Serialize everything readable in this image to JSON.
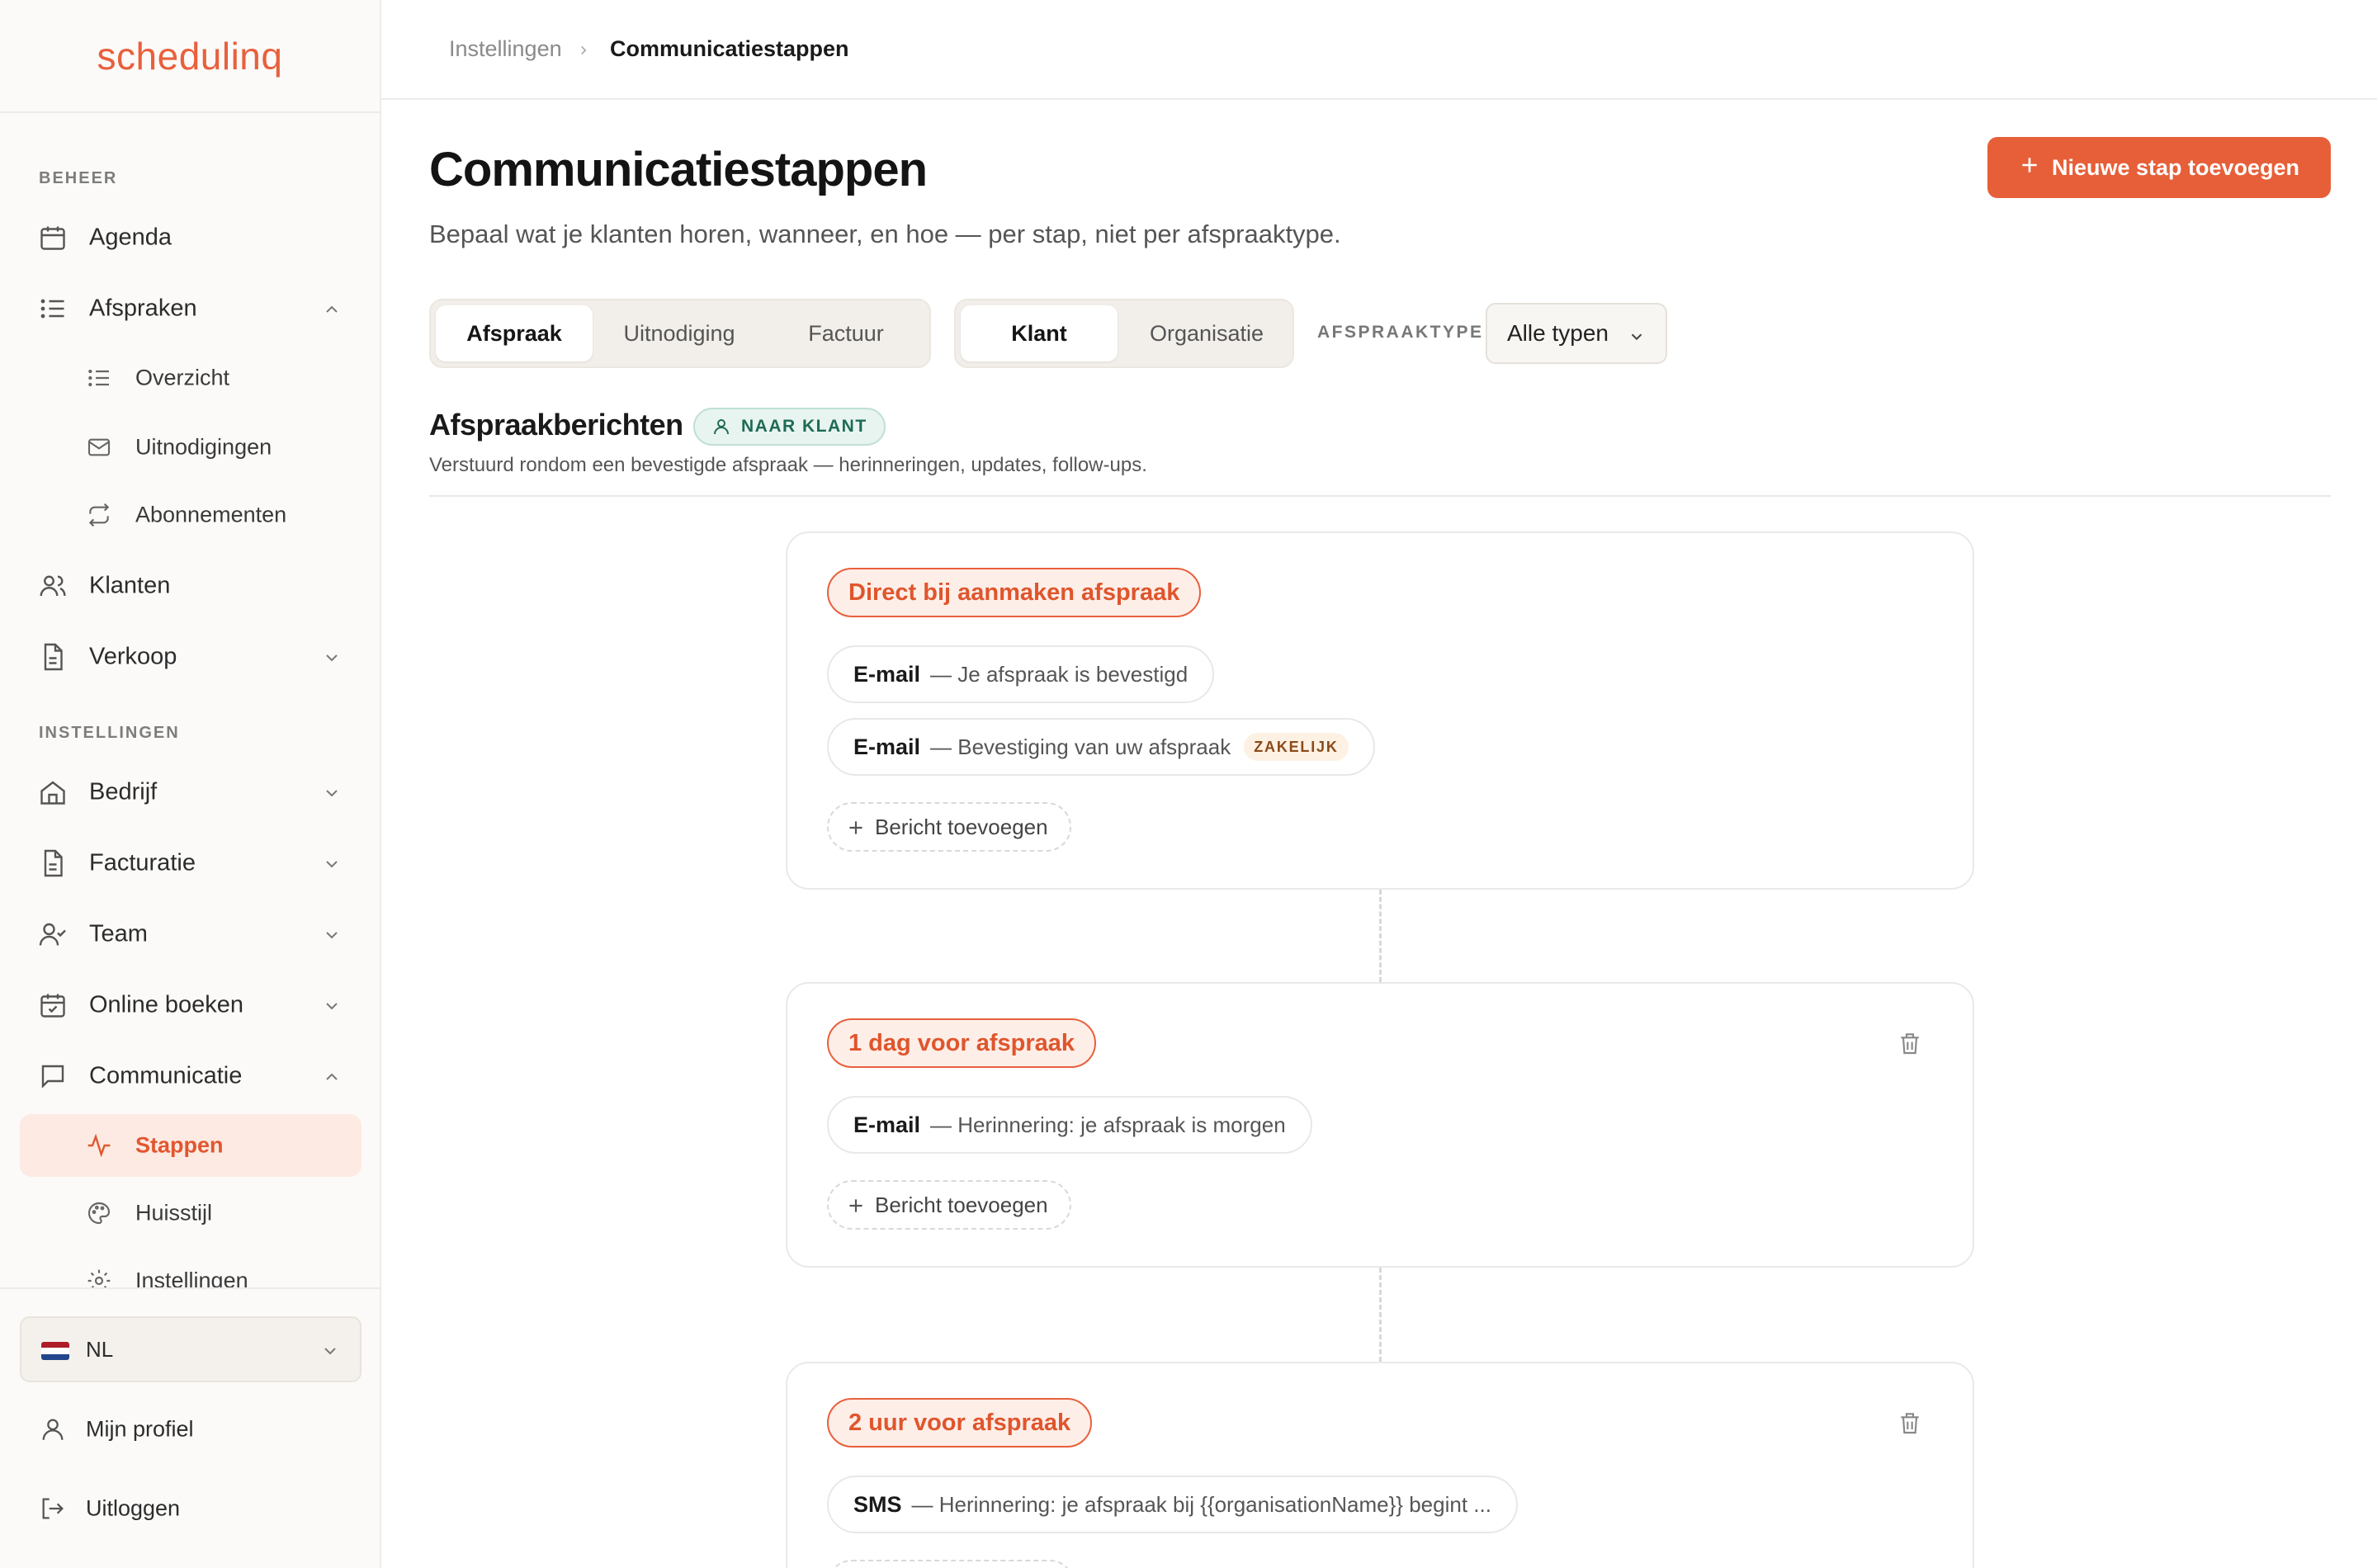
{
  "brand": {
    "logo_text": "schedulinq",
    "accent": "#e65f39"
  },
  "sidebar": {
    "section_manage": "BEHEER",
    "section_settings": "INSTELLINGEN",
    "agenda": "Agenda",
    "afspraken": "Afspraken",
    "overzicht": "Overzicht",
    "uitnodigingen": "Uitnodigingen",
    "abonnementen": "Abonnementen",
    "klanten": "Klanten",
    "verkoop": "Verkoop",
    "bedrijf": "Bedrijf",
    "facturatie": "Facturatie",
    "team": "Team",
    "online_boeken": "Online boeken",
    "communicatie": "Communicatie",
    "stappen": "Stappen",
    "huisstijl": "Huisstijl",
    "instellingen": "Instellingen",
    "language": "NL",
    "profile": "Mijn profiel",
    "logout": "Uitloggen"
  },
  "breadcrumb": {
    "parent": "Instellingen",
    "current": "Communicatiestappen"
  },
  "page": {
    "title": "Communicatiestappen",
    "subtitle": "Bepaal wat je klanten horen, wanneer, en hoe — per stap, niet per afspraaktype.",
    "new_step_button": "Nieuwe stap toevoegen"
  },
  "tabs": {
    "category": [
      "Afspraak",
      "Uitnodiging",
      "Factuur"
    ],
    "category_selected": "Afspraak",
    "audience": [
      "Klant",
      "Organisatie"
    ],
    "audience_selected": "Klant",
    "filter_label": "AFSPRAAKTYPE",
    "filter_value": "Alle typen"
  },
  "section": {
    "title": "Afspraakberichten",
    "badge": "NAAR KLANT",
    "description": "Verstuurd rondom een bevestigde afspraak — herinneringen, updates, follow-ups."
  },
  "steps": [
    {
      "trigger": "Direct bij aanmaken afspraak",
      "messages": [
        {
          "channel": "E-mail",
          "subject": "— Je afspraak is bevestigd",
          "tag": ""
        },
        {
          "channel": "E-mail",
          "subject": "— Bevestiging van uw afspraak",
          "tag": "ZAKELIJK"
        }
      ],
      "add_label": "Bericht toevoegen"
    },
    {
      "trigger": "1 dag voor afspraak",
      "messages": [
        {
          "channel": "E-mail",
          "subject": "— Herinnering: je afspraak is morgen",
          "tag": ""
        }
      ],
      "add_label": "Bericht toevoegen"
    },
    {
      "trigger": "2 uur voor afspraak",
      "messages": [
        {
          "channel": "SMS",
          "subject": "— Herinnering: je afspraak bij {{organisationName}} begint ...",
          "tag": ""
        }
      ],
      "add_label": ""
    }
  ]
}
